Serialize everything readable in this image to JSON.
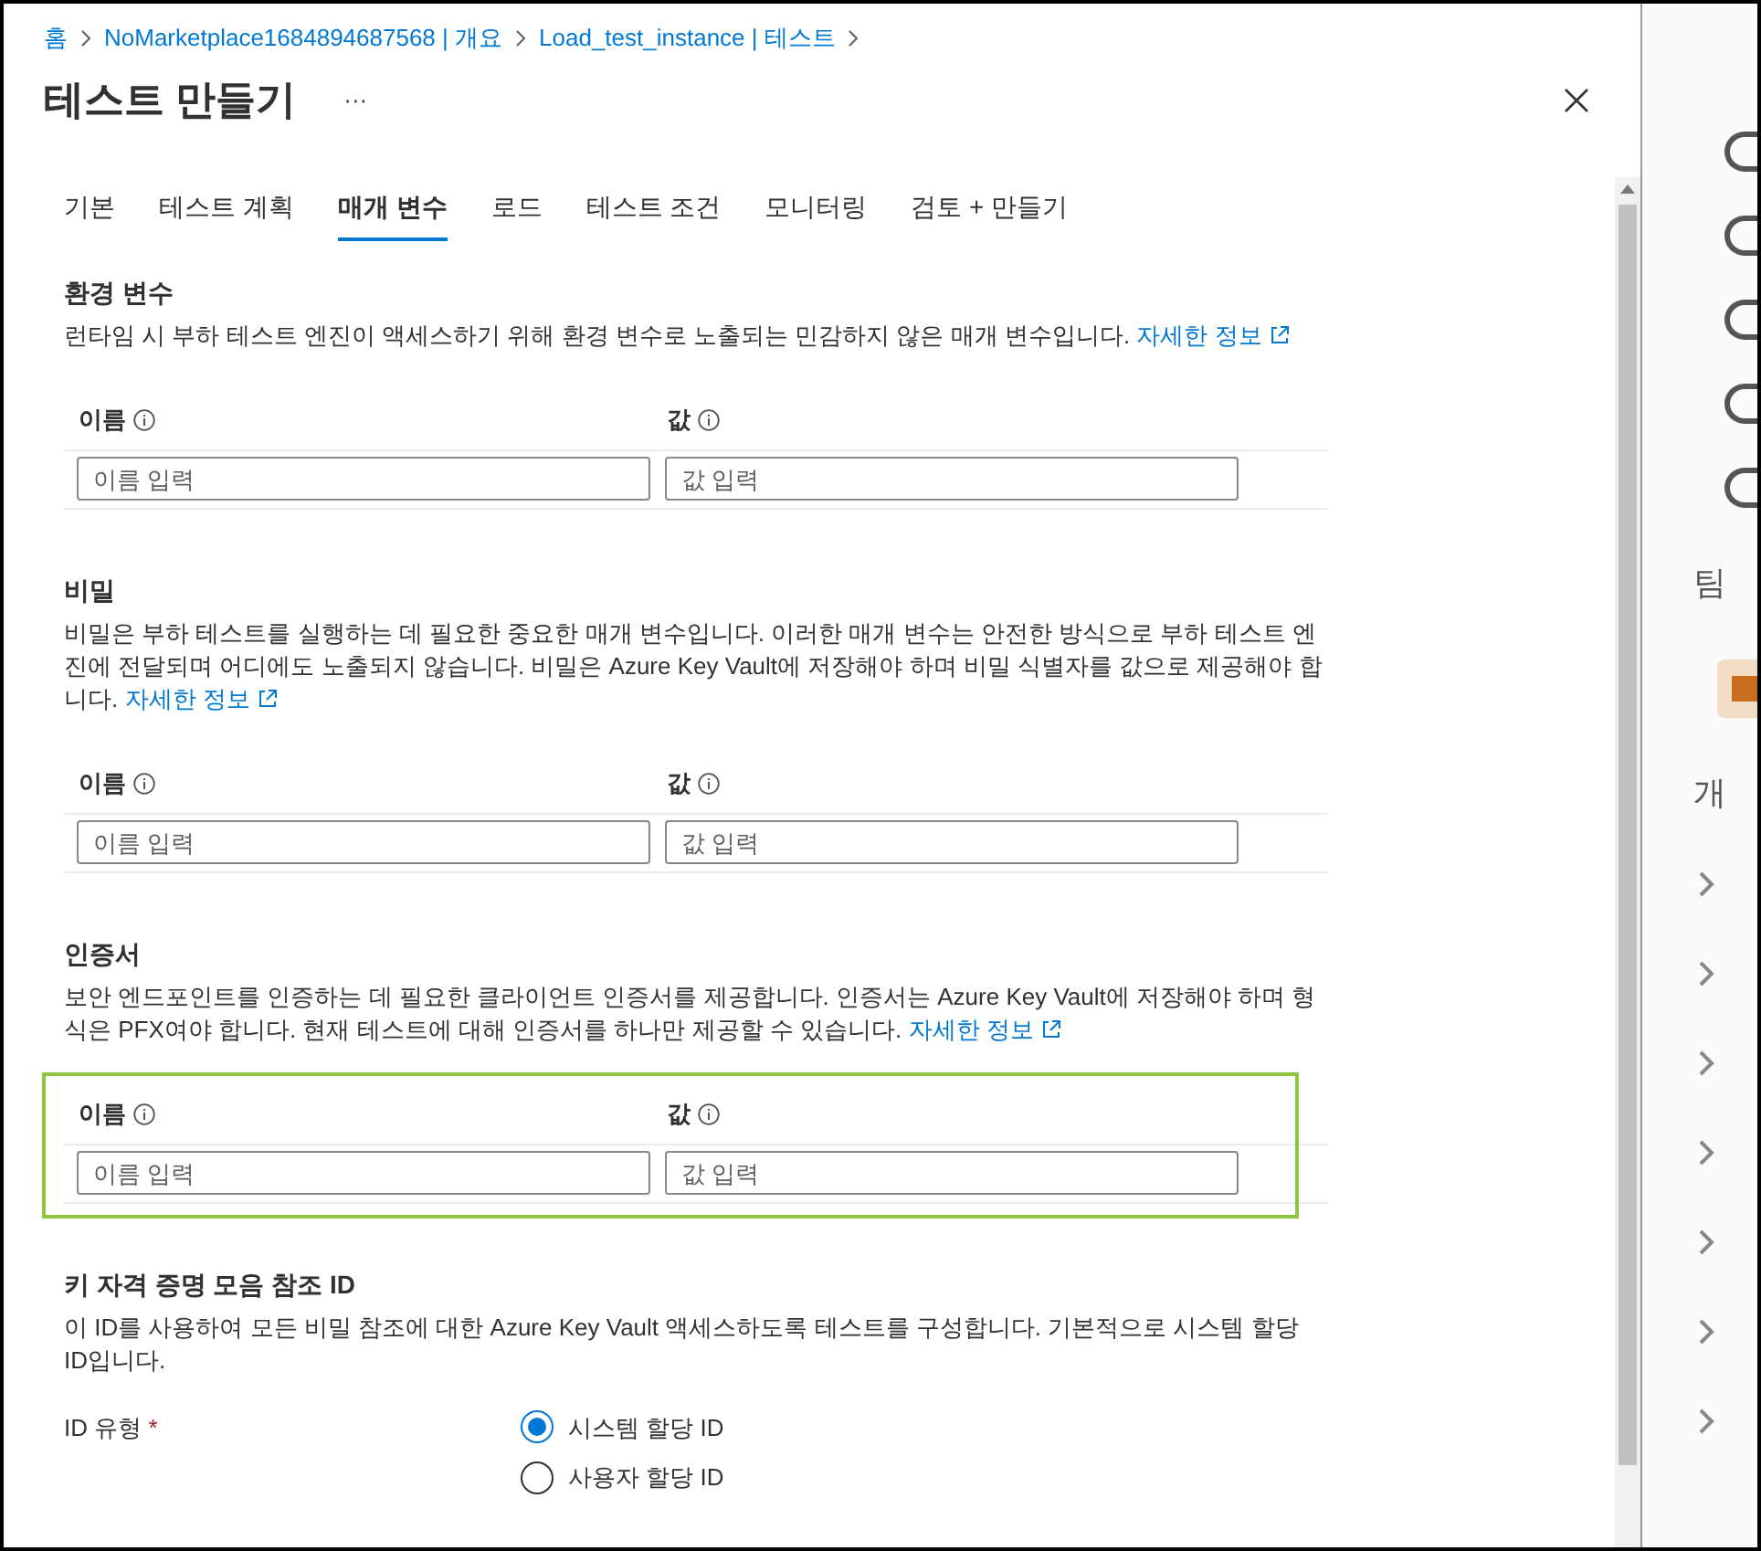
{
  "breadcrumb": [
    "홈",
    "NoMarketplace1684894687568 | 개요",
    "Load_test_instance | 테스트"
  ],
  "title": "테스트 만들기",
  "more": "···",
  "tabs": [
    {
      "label": "기본",
      "selected": false
    },
    {
      "label": "테스트 계획",
      "selected": false
    },
    {
      "label": "매개 변수",
      "selected": true
    },
    {
      "label": "로드",
      "selected": false
    },
    {
      "label": "테스트 조건",
      "selected": false
    },
    {
      "label": "모니터링",
      "selected": false
    },
    {
      "label": "검토 + 만들기",
      "selected": false
    }
  ],
  "sections": [
    {
      "kind": "table",
      "title": "환경 변수",
      "description": "런타임 시 부하 테스트 엔진이 액세스하기 위해 환경 변수로 노출되는 민감하지 않은 매개 변수입니다.",
      "link": "자세한 정보",
      "highlighted": false,
      "columns": [
        "이름",
        "값"
      ],
      "placeholders": [
        "이름 입력",
        "값 입력"
      ]
    },
    {
      "kind": "table",
      "title": "비밀",
      "description": "비밀은 부하 테스트를 실행하는 데 필요한 중요한 매개 변수입니다. 이러한 매개 변수는 안전한 방식으로 부하 테스트 엔진에 전달되며 어디에도 노출되지 않습니다. 비밀은 Azure Key Vault에 저장해야 하며 비밀 식별자를 값으로 제공해야 합니다.",
      "link": "자세한 정보",
      "highlighted": false,
      "columns": [
        "이름",
        "값"
      ],
      "placeholders": [
        "이름 입력",
        "값 입력"
      ]
    },
    {
      "kind": "table",
      "title": "인증서",
      "description": "보안 엔드포인트를 인증하는 데 필요한 클라이언트 인증서를 제공합니다. 인증서는 Azure Key Vault에 저장해야 하며 형식은 PFX여야 합니다. 현재 테스트에 대해 인증서를 하나만 제공할 수 있습니다.",
      "link": "자세한 정보",
      "highlighted": true,
      "columns": [
        "이름",
        "값"
      ],
      "placeholders": [
        "이름 입력",
        "값 입력"
      ]
    },
    {
      "kind": "radio",
      "title": "키 자격 증명 모음 참조 ID",
      "description": "이 ID를 사용하여 모든 비밀 참조에 대한 Azure Key Vault 액세스하도록 테스트를 구성합니다. 기본적으로 시스템 할당 ID입니다.",
      "field_label": "ID 유형",
      "required_mark": "*",
      "options": [
        {
          "label": "시스템 할당 ID",
          "selected": true
        },
        {
          "label": "사용자 할당 ID",
          "selected": false
        }
      ]
    }
  ],
  "side_texts": [
    "팀",
    "개"
  ]
}
